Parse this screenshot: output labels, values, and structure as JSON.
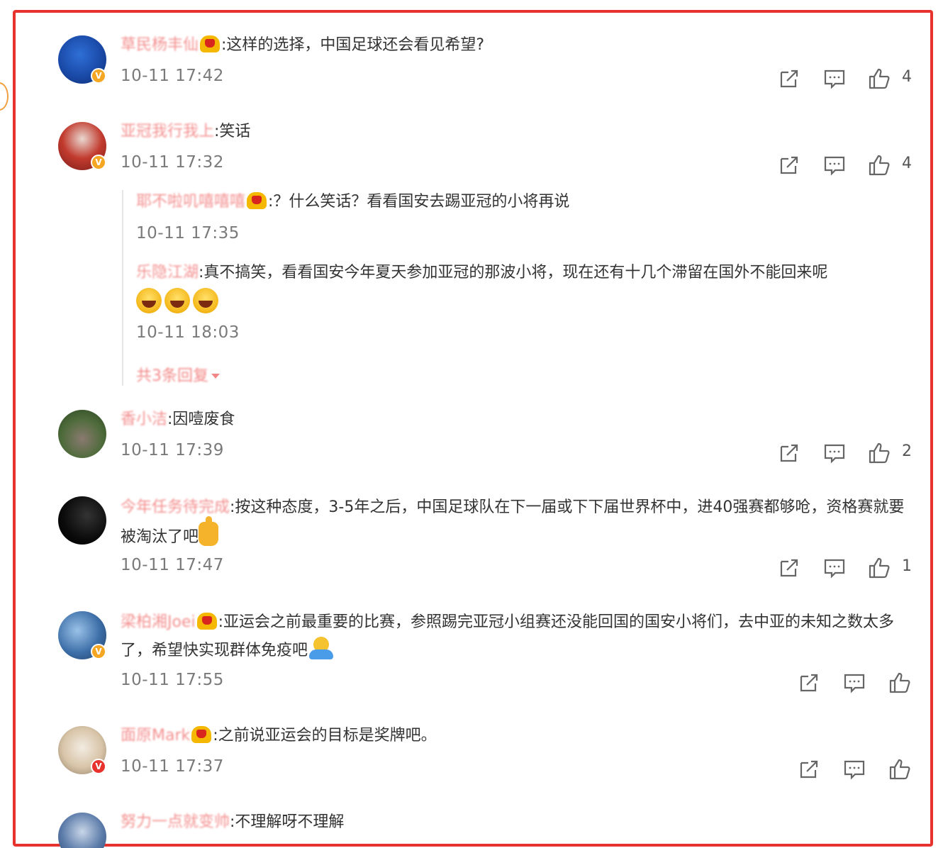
{
  "comments": [
    {
      "username": "草民杨丰仙",
      "vip": true,
      "text": ":这样的选择，中国足球还会看见希望?",
      "time": "10-11 17:42",
      "likes": "4",
      "avatar_badge": "v-gold"
    },
    {
      "username": "亚冠我行我上",
      "vip": false,
      "text": ":笑话",
      "time": "10-11 17:32",
      "likes": "4",
      "avatar_badge": "v-gold",
      "replies": [
        {
          "username": "耶不啦叽嘻嘻嘻",
          "vip": true,
          "text": ":？什么笑话？看看国安去踢亚冠的小将再说",
          "time": "10-11 17:35"
        },
        {
          "username": "乐隐江湖",
          "vip": false,
          "text": ":真不搞笑，看看国安今年夏天参加亚冠的那波小将，现在还有十几个滞留在国外不能回来呢",
          "time": "10-11 18:03"
        }
      ],
      "more_replies_label": "共3条回复"
    },
    {
      "username": "香小洁",
      "vip": false,
      "text": ":因噎废食",
      "time": "10-11 17:39",
      "likes": "2"
    },
    {
      "username": "今年任务待完成",
      "vip": false,
      "text": ":按这种态度，3-5年之后，中国足球队在下一届或下下届世界杯中，进40强赛都够呛，资格赛就要被淘汰了吧",
      "time": "10-11 17:47",
      "likes": "1"
    },
    {
      "username": "梁柏湘Joei",
      "vip": true,
      "text": ":亚运会之前最重要的比赛，参照踢完亚冠小组赛还没能回国的国安小将们，去中亚的未知之数太多了，希望快实现群体免疫吧",
      "time": "10-11 17:55",
      "avatar_badge": "v-gold"
    },
    {
      "username": "面原Mark",
      "vip": true,
      "text": ":之前说亚运会的目标是奖牌吧。",
      "time": "10-11 17:37",
      "avatar_badge": "v-red"
    },
    {
      "username": "努力一点就变帅",
      "vip": false,
      "text": ":不理解呀不理解"
    }
  ],
  "icons": {
    "share": "share-icon",
    "comment": "comment-icon",
    "like": "like-icon"
  },
  "colors": {
    "frame": "#e8322e",
    "username": "#f06a6a",
    "text": "#333333",
    "time": "#7a7a7a"
  }
}
